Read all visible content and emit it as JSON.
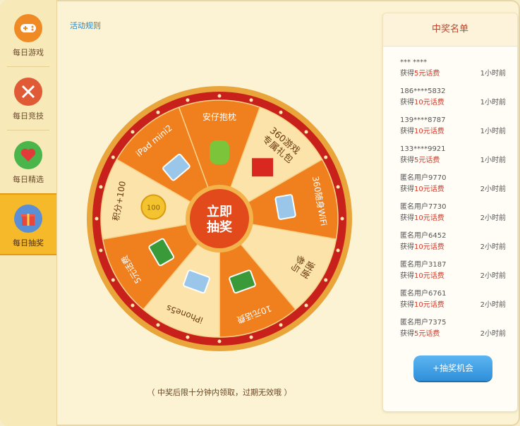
{
  "sidebar": {
    "items": [
      {
        "label": "每日游戏",
        "icon": "gamepad-icon",
        "color": "#f08a24",
        "active": false
      },
      {
        "label": "每日竞技",
        "icon": "swords-icon",
        "color": "#e05a35",
        "active": false
      },
      {
        "label": "每日精选",
        "icon": "heart-icon",
        "color": "#49b54a",
        "active": false
      },
      {
        "label": "每日抽奖",
        "icon": "gift-icon",
        "color": "#5a8fd6",
        "active": true
      }
    ]
  },
  "main": {
    "rules_link": "活动规则",
    "note": "（ 中奖后限十分钟内领取，过期无效哦 ）",
    "wheel": {
      "center_line1": "立即",
      "center_line2": "抽奖",
      "segments": [
        {
          "label": "安仔抱枕",
          "icon": "android-plush-icon"
        },
        {
          "label": "360游戏\n专属礼包",
          "icon": "gift-box-icon"
        },
        {
          "label": "360随身WiFi",
          "icon": "wifi-dongle-icon"
        },
        {
          "label": "谢谢\n参与",
          "icon": ""
        },
        {
          "label": "10元话费",
          "icon": "phone-card-icon"
        },
        {
          "label": "iPhone5s",
          "icon": "iphone-icon"
        },
        {
          "label": "5元话费",
          "icon": "phone-card-icon"
        },
        {
          "label": "积分+100",
          "icon": "coin-icon"
        },
        {
          "label": "iPad mini2",
          "icon": "ipad-icon"
        }
      ],
      "coin_text": "100",
      "colors": {
        "segment_dark": "#f07f1e",
        "segment_light": "#fbe3a9",
        "rim": "#c8211b",
        "rim_outer": "#e9a43a",
        "center": "#e24a1c"
      }
    }
  },
  "panel": {
    "title": "中奖名单",
    "winners": [
      {
        "user": "***  ****",
        "prefix": "获得",
        "prize": "5元话费",
        "time": "1小时前"
      },
      {
        "user": "186****5832",
        "prefix": "获得",
        "prize": "10元话费",
        "time": "1小时前"
      },
      {
        "user": "139****8787",
        "prefix": "获得",
        "prize": "10元话费",
        "time": "1小时前"
      },
      {
        "user": "133****9921",
        "prefix": "获得",
        "prize": "5元话费",
        "time": "1小时前"
      },
      {
        "user": "匿名用户9770",
        "prefix": "获得",
        "prize": "10元话费",
        "time": "2小时前"
      },
      {
        "user": "匿名用户7730",
        "prefix": "获得",
        "prize": "10元话费",
        "time": "2小时前"
      },
      {
        "user": "匿名用户6452",
        "prefix": "获得",
        "prize": "10元话费",
        "time": "2小时前"
      },
      {
        "user": "匿名用户3187",
        "prefix": "获得",
        "prize": "10元话费",
        "time": "2小时前"
      },
      {
        "user": "匿名用户6761",
        "prefix": "获得",
        "prize": "10元话费",
        "time": "2小时前"
      },
      {
        "user": "匿名用户7375",
        "prefix": "获得",
        "prize": "5元话费",
        "time": "2小时前"
      }
    ],
    "add_button": "+抽奖机会"
  }
}
